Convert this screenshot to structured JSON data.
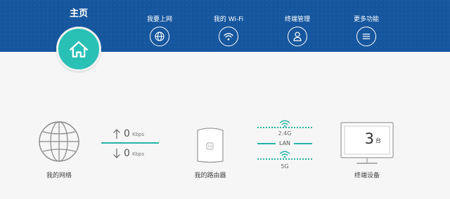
{
  "nav": {
    "home_label": "主页",
    "items": [
      {
        "label": "我要上网",
        "icon": "globe-icon"
      },
      {
        "label": "我的 Wi-Fi",
        "icon": "wifi-icon"
      },
      {
        "label": "终端管理",
        "icon": "user-icon"
      },
      {
        "label": "更多功能",
        "icon": "menu-icon"
      }
    ]
  },
  "network": {
    "label": "我的网络"
  },
  "speed": {
    "upload_value": "0",
    "upload_unit": "Kbps",
    "download_value": "0",
    "download_unit": "Kbps"
  },
  "router": {
    "label": "我的路由器"
  },
  "bands": {
    "band_24": "2.4G",
    "lan": "LAN",
    "band_5": "5G"
  },
  "devices": {
    "count": "3",
    "unit": "台",
    "label": "终端设备"
  },
  "colors": {
    "header": "#15569e",
    "accent": "#29c0b6",
    "line": "#26b3a6"
  }
}
